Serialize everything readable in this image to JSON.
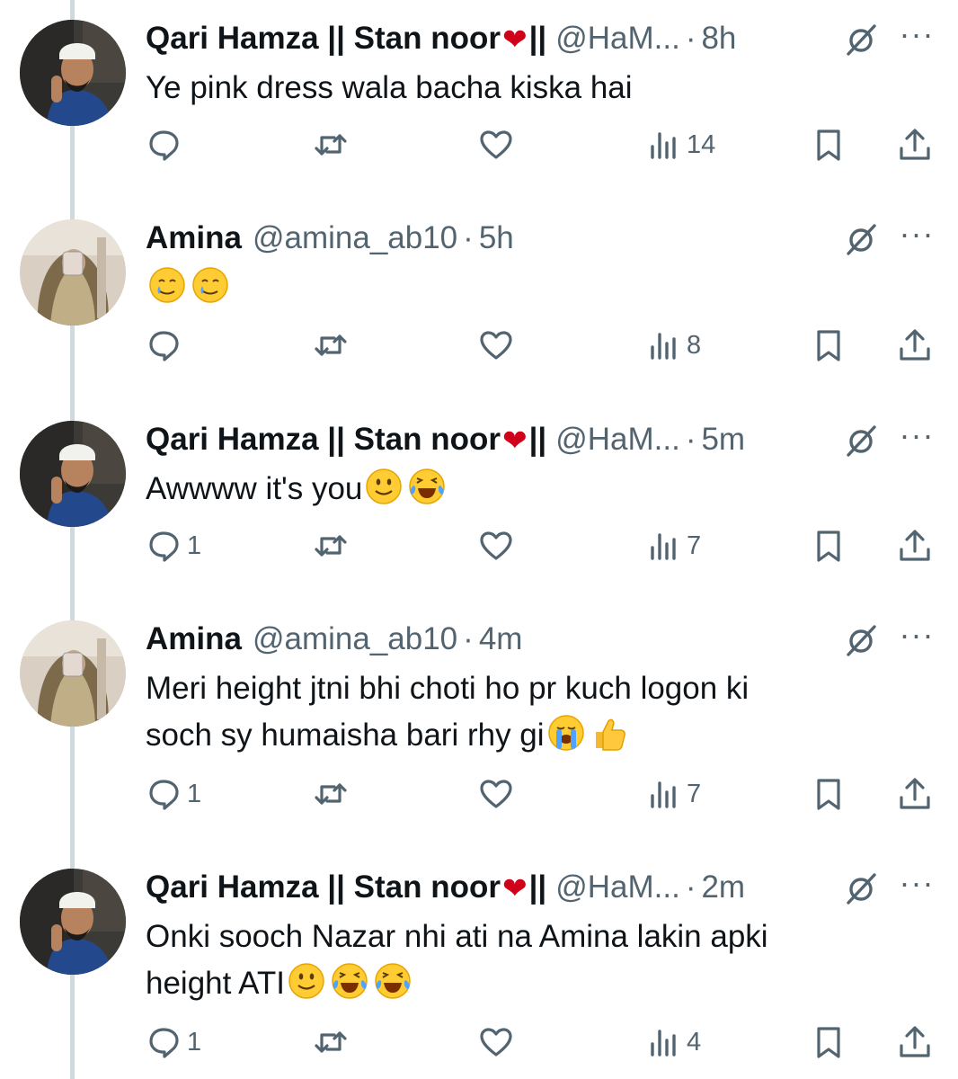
{
  "tweets": [
    {
      "author": "Qari Hamza || Stan noor",
      "name_pre": "Qari Hamza || Stan noor",
      "name_post": "||",
      "heart": "❤",
      "handle": "@HaM...",
      "time": "8h",
      "text": "Ye pink dress wala bacha kiska hai",
      "emojis": [],
      "reply_count": "",
      "views": "14"
    },
    {
      "author": "Amina",
      "name_pre": "Amina",
      "name_post": "",
      "heart": "",
      "handle": "@amina_ab10",
      "time": "5h",
      "text": "",
      "emojis": [
        "crying-smile-emoji",
        "crying-smile-emoji"
      ],
      "reply_count": "",
      "views": "8"
    },
    {
      "author": "Qari Hamza || Stan noor",
      "name_pre": "Qari Hamza || Stan noor",
      "name_post": "||",
      "heart": "❤",
      "handle": "@HaM...",
      "time": "5m",
      "text": "Awwww it's you",
      "emojis": [
        "slight-smile-emoji",
        "laughing-tears-emoji"
      ],
      "reply_count": "1",
      "views": "7"
    },
    {
      "author": "Amina",
      "name_pre": "Amina",
      "name_post": "",
      "heart": "",
      "handle": "@amina_ab10",
      "time": "4m",
      "text_line1": "Meri height jtni bhi choti ho pr kuch logon ki",
      "text_line2": "soch sy humaisha bari rhy gi",
      "emojis": [
        "loudly-crying-emoji",
        "thumbs-up-emoji"
      ],
      "reply_count": "1",
      "views": "7"
    },
    {
      "author": "Qari Hamza || Stan noor",
      "name_pre": "Qari Hamza || Stan noor",
      "name_post": "||",
      "heart": "❤",
      "handle": "@HaM...",
      "time": "2m",
      "text_line1": "Onki sooch Nazar nhi ati na Amina lakin apki",
      "text_line2": "height ATI",
      "emojis": [
        "slight-smile-emoji",
        "laughing-tears-emoji",
        "laughing-tears-emoji"
      ],
      "reply_count": "1",
      "views": "4"
    }
  ],
  "dot": "·",
  "more_label": "···",
  "colors": {
    "text": "#0f1419",
    "muted": "#536471",
    "thread": "#cfd9de",
    "heart": "#d0021b"
  }
}
